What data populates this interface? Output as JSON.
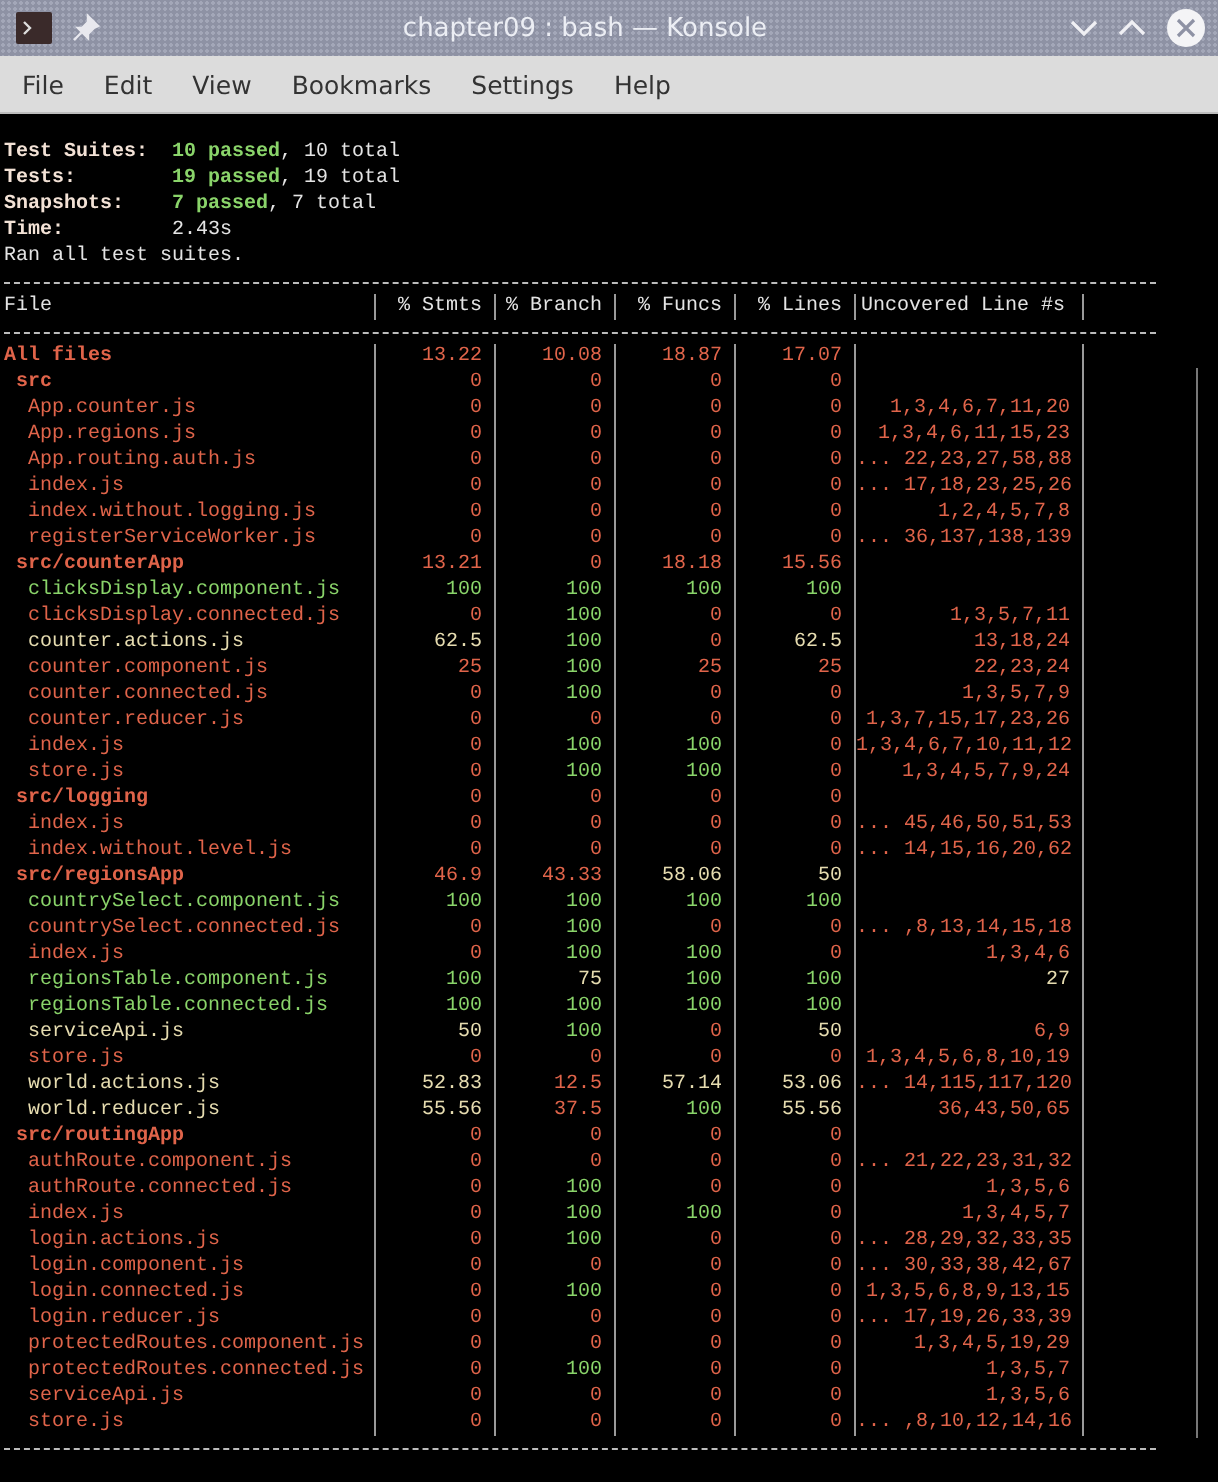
{
  "window": {
    "title": "chapter09 : bash — Konsole"
  },
  "menu": [
    "File",
    "Edit",
    "View",
    "Bookmarks",
    "Settings",
    "Help"
  ],
  "summary": [
    {
      "kind": "counts",
      "label": "Test Suites:",
      "passed": "10 passed",
      "rest": ", 10 total"
    },
    {
      "kind": "counts",
      "label": "Tests:",
      "passed": "19 passed",
      "rest": ", 19 total"
    },
    {
      "kind": "counts",
      "label": "Snapshots:",
      "passed": "7 passed",
      "rest": ", 7 total"
    },
    {
      "kind": "value",
      "label": "Time:",
      "value": "2.43s"
    }
  ],
  "message": "Ran all test suites.",
  "coverage": {
    "columns": [
      "File",
      "% Stmts",
      "% Branch",
      "% Funcs",
      "% Lines",
      "Uncovered Line #s"
    ],
    "rows": [
      {
        "cells": [
          {
            "text": "All files",
            "color": "#e0644a"
          },
          {
            "text": "13.22",
            "color": "#e0644a"
          },
          {
            "text": "10.08",
            "color": "#e0644a"
          },
          {
            "text": "18.87",
            "color": "#e0644a"
          },
          {
            "text": "17.07",
            "color": "#e0644a"
          }
        ],
        "children": [
          {
            "cells": [
              {
                "text": "src",
                "color": "#e0644a"
              },
              {
                "text": "0",
                "color": "#e0644a"
              },
              {
                "text": "0",
                "color": "#e0644a"
              },
              {
                "text": "0",
                "color": "#e0644a"
              },
              {
                "text": "0",
                "color": "#e0644a"
              }
            ],
            "children": [
              {
                "cells": [
                  {
                    "text": "App.counter.js",
                    "color": "#e0644a"
                  },
                  {
                    "text": "0",
                    "color": "#e0644a"
                  },
                  {
                    "text": "0",
                    "color": "#e0644a"
                  },
                  {
                    "text": "0",
                    "color": "#e0644a"
                  },
                  {
                    "text": "0",
                    "color": "#e0644a"
                  },
                  {
                    "text": "1,3,4,6,7,11,20",
                    "color": "#e0644a"
                  }
                ]
              },
              {
                "cells": [
                  {
                    "text": "App.regions.js",
                    "color": "#e0644a"
                  },
                  {
                    "text": "0",
                    "color": "#e0644a"
                  },
                  {
                    "text": "0",
                    "color": "#e0644a"
                  },
                  {
                    "text": "0",
                    "color": "#e0644a"
                  },
                  {
                    "text": "0",
                    "color": "#e0644a"
                  },
                  {
                    "text": "1,3,4,6,11,15,23",
                    "color": "#e0644a"
                  }
                ]
              },
              {
                "cells": [
                  {
                    "text": "App.routing.auth.js",
                    "color": "#e0644a"
                  },
                  {
                    "text": "0",
                    "color": "#e0644a"
                  },
                  {
                    "text": "0",
                    "color": "#e0644a"
                  },
                  {
                    "text": "0",
                    "color": "#e0644a"
                  },
                  {
                    "text": "0",
                    "color": "#e0644a"
                  },
                  {
                    "text": "... 22,23,27,58,88",
                    "color": "#e0644a"
                  }
                ]
              },
              {
                "cells": [
                  {
                    "text": "index.js",
                    "color": "#e0644a"
                  },
                  {
                    "text": "0",
                    "color": "#e0644a"
                  },
                  {
                    "text": "0",
                    "color": "#e0644a"
                  },
                  {
                    "text": "0",
                    "color": "#e0644a"
                  },
                  {
                    "text": "0",
                    "color": "#e0644a"
                  },
                  {
                    "text": "... 17,18,23,25,26",
                    "color": "#e0644a"
                  }
                ]
              },
              {
                "cells": [
                  {
                    "text": "index.without.logging.js",
                    "color": "#e0644a"
                  },
                  {
                    "text": "0",
                    "color": "#e0644a"
                  },
                  {
                    "text": "0",
                    "color": "#e0644a"
                  },
                  {
                    "text": "0",
                    "color": "#e0644a"
                  },
                  {
                    "text": "0",
                    "color": "#e0644a"
                  },
                  {
                    "text": "1,2,4,5,7,8",
                    "color": "#e0644a"
                  }
                ]
              },
              {
                "cells": [
                  {
                    "text": "registerServiceWorker.js",
                    "color": "#e0644a"
                  },
                  {
                    "text": "0",
                    "color": "#e0644a"
                  },
                  {
                    "text": "0",
                    "color": "#e0644a"
                  },
                  {
                    "text": "0",
                    "color": "#e0644a"
                  },
                  {
                    "text": "0",
                    "color": "#e0644a"
                  },
                  {
                    "text": "... 36,137,138,139",
                    "color": "#e0644a"
                  }
                ]
              }
            ]
          },
          {
            "cells": [
              {
                "text": "src/counterApp",
                "color": "#e0644a"
              },
              {
                "text": "13.21",
                "color": "#e0644a"
              },
              {
                "text": "0",
                "color": "#e0644a"
              },
              {
                "text": "18.18",
                "color": "#e0644a"
              },
              {
                "text": "15.56",
                "color": "#e0644a"
              }
            ],
            "children": [
              {
                "cells": [
                  {
                    "text": "clicksDisplay.component.js",
                    "color": "#8ad46a"
                  },
                  {
                    "text": "100",
                    "color": "#8ad46a"
                  },
                  {
                    "text": "100",
                    "color": "#8ad46a"
                  },
                  {
                    "text": "100",
                    "color": "#8ad46a"
                  },
                  {
                    "text": "100",
                    "color": "#8ad46a"
                  }
                ]
              },
              {
                "cells": [
                  {
                    "text": "clicksDisplay.connected.js",
                    "color": "#e0644a"
                  },
                  {
                    "text": "0",
                    "color": "#e0644a"
                  },
                  {
                    "text": "100",
                    "color": "#8ad46a"
                  },
                  {
                    "text": "0",
                    "color": "#e0644a"
                  },
                  {
                    "text": "0",
                    "color": "#e0644a"
                  },
                  {
                    "text": "1,3,5,7,11",
                    "color": "#e0644a"
                  }
                ]
              },
              {
                "cells": [
                  {
                    "text": "counter.actions.js",
                    "color": "#e6dcb0"
                  },
                  {
                    "text": "62.5",
                    "color": "#e6dcb0"
                  },
                  {
                    "text": "100",
                    "color": "#8ad46a"
                  },
                  {
                    "text": "0",
                    "color": "#e0644a"
                  },
                  {
                    "text": "62.5",
                    "color": "#e6dcb0"
                  },
                  {
                    "text": "13,18,24",
                    "color": "#e0644a"
                  }
                ]
              },
              {
                "cells": [
                  {
                    "text": "counter.component.js",
                    "color": "#e0644a"
                  },
                  {
                    "text": "25",
                    "color": "#e0644a"
                  },
                  {
                    "text": "100",
                    "color": "#8ad46a"
                  },
                  {
                    "text": "25",
                    "color": "#e0644a"
                  },
                  {
                    "text": "25",
                    "color": "#e0644a"
                  },
                  {
                    "text": "22,23,24",
                    "color": "#e0644a"
                  }
                ]
              },
              {
                "cells": [
                  {
                    "text": "counter.connected.js",
                    "color": "#e0644a"
                  },
                  {
                    "text": "0",
                    "color": "#e0644a"
                  },
                  {
                    "text": "100",
                    "color": "#8ad46a"
                  },
                  {
                    "text": "0",
                    "color": "#e0644a"
                  },
                  {
                    "text": "0",
                    "color": "#e0644a"
                  },
                  {
                    "text": "1,3,5,7,9",
                    "color": "#e0644a"
                  }
                ]
              },
              {
                "cells": [
                  {
                    "text": "counter.reducer.js",
                    "color": "#e0644a"
                  },
                  {
                    "text": "0",
                    "color": "#e0644a"
                  },
                  {
                    "text": "0",
                    "color": "#e0644a"
                  },
                  {
                    "text": "0",
                    "color": "#e0644a"
                  },
                  {
                    "text": "0",
                    "color": "#e0644a"
                  },
                  {
                    "text": "1,3,7,15,17,23,26",
                    "color": "#e0644a"
                  }
                ]
              },
              {
                "cells": [
                  {
                    "text": "index.js",
                    "color": "#e0644a"
                  },
                  {
                    "text": "0",
                    "color": "#e0644a"
                  },
                  {
                    "text": "100",
                    "color": "#8ad46a"
                  },
                  {
                    "text": "100",
                    "color": "#8ad46a"
                  },
                  {
                    "text": "0",
                    "color": "#e0644a"
                  },
                  {
                    "text": "1,3,4,6,7,10,11,12",
                    "color": "#e0644a"
                  }
                ]
              },
              {
                "cells": [
                  {
                    "text": "store.js",
                    "color": "#e0644a"
                  },
                  {
                    "text": "0",
                    "color": "#e0644a"
                  },
                  {
                    "text": "100",
                    "color": "#8ad46a"
                  },
                  {
                    "text": "100",
                    "color": "#8ad46a"
                  },
                  {
                    "text": "0",
                    "color": "#e0644a"
                  },
                  {
                    "text": "1,3,4,5,7,9,24",
                    "color": "#e0644a"
                  }
                ]
              }
            ]
          },
          {
            "cells": [
              {
                "text": "src/logging",
                "color": "#e0644a"
              },
              {
                "text": "0",
                "color": "#e0644a"
              },
              {
                "text": "0",
                "color": "#e0644a"
              },
              {
                "text": "0",
                "color": "#e0644a"
              },
              {
                "text": "0",
                "color": "#e0644a"
              }
            ],
            "children": [
              {
                "cells": [
                  {
                    "text": "index.js",
                    "color": "#e0644a"
                  },
                  {
                    "text": "0",
                    "color": "#e0644a"
                  },
                  {
                    "text": "0",
                    "color": "#e0644a"
                  },
                  {
                    "text": "0",
                    "color": "#e0644a"
                  },
                  {
                    "text": "0",
                    "color": "#e0644a"
                  },
                  {
                    "text": "... 45,46,50,51,53",
                    "color": "#e0644a"
                  }
                ]
              },
              {
                "cells": [
                  {
                    "text": "index.without.level.js",
                    "color": "#e0644a"
                  },
                  {
                    "text": "0",
                    "color": "#e0644a"
                  },
                  {
                    "text": "0",
                    "color": "#e0644a"
                  },
                  {
                    "text": "0",
                    "color": "#e0644a"
                  },
                  {
                    "text": "0",
                    "color": "#e0644a"
                  },
                  {
                    "text": "... 14,15,16,20,62",
                    "color": "#e0644a"
                  }
                ]
              }
            ]
          },
          {
            "cells": [
              {
                "text": "src/regionsApp",
                "color": "#e0644a"
              },
              {
                "text": "46.9",
                "color": "#e0644a"
              },
              {
                "text": "43.33",
                "color": "#e0644a"
              },
              {
                "text": "58.06",
                "color": "#e6dcb0"
              },
              {
                "text": "50",
                "color": "#e6dcb0"
              }
            ],
            "children": [
              {
                "cells": [
                  {
                    "text": "countrySelect.component.js",
                    "color": "#8ad46a"
                  },
                  {
                    "text": "100",
                    "color": "#8ad46a"
                  },
                  {
                    "text": "100",
                    "color": "#8ad46a"
                  },
                  {
                    "text": "100",
                    "color": "#8ad46a"
                  },
                  {
                    "text": "100",
                    "color": "#8ad46a"
                  }
                ]
              },
              {
                "cells": [
                  {
                    "text": "countrySelect.connected.js",
                    "color": "#e0644a"
                  },
                  {
                    "text": "0",
                    "color": "#e0644a"
                  },
                  {
                    "text": "100",
                    "color": "#8ad46a"
                  },
                  {
                    "text": "0",
                    "color": "#e0644a"
                  },
                  {
                    "text": "0",
                    "color": "#e0644a"
                  },
                  {
                    "text": "... ,8,13,14,15,18",
                    "color": "#e0644a"
                  }
                ]
              },
              {
                "cells": [
                  {
                    "text": "index.js",
                    "color": "#e0644a"
                  },
                  {
                    "text": "0",
                    "color": "#e0644a"
                  },
                  {
                    "text": "100",
                    "color": "#8ad46a"
                  },
                  {
                    "text": "100",
                    "color": "#8ad46a"
                  },
                  {
                    "text": "0",
                    "color": "#e0644a"
                  },
                  {
                    "text": "1,3,4,6",
                    "color": "#e0644a"
                  }
                ]
              },
              {
                "cells": [
                  {
                    "text": "regionsTable.component.js",
                    "color": "#8ad46a"
                  },
                  {
                    "text": "100",
                    "color": "#8ad46a"
                  },
                  {
                    "text": "75",
                    "color": "#e6dcb0"
                  },
                  {
                    "text": "100",
                    "color": "#8ad46a"
                  },
                  {
                    "text": "100",
                    "color": "#8ad46a"
                  },
                  {
                    "text": "27",
                    "color": "#e6dcb0"
                  }
                ]
              },
              {
                "cells": [
                  {
                    "text": "regionsTable.connected.js",
                    "color": "#8ad46a"
                  },
                  {
                    "text": "100",
                    "color": "#8ad46a"
                  },
                  {
                    "text": "100",
                    "color": "#8ad46a"
                  },
                  {
                    "text": "100",
                    "color": "#8ad46a"
                  },
                  {
                    "text": "100",
                    "color": "#8ad46a"
                  }
                ]
              },
              {
                "cells": [
                  {
                    "text": "serviceApi.js",
                    "color": "#e6dcb0"
                  },
                  {
                    "text": "50",
                    "color": "#e6dcb0"
                  },
                  {
                    "text": "100",
                    "color": "#8ad46a"
                  },
                  {
                    "text": "0",
                    "color": "#e0644a"
                  },
                  {
                    "text": "50",
                    "color": "#e6dcb0"
                  },
                  {
                    "text": "6,9",
                    "color": "#e0644a"
                  }
                ]
              },
              {
                "cells": [
                  {
                    "text": "store.js",
                    "color": "#e0644a"
                  },
                  {
                    "text": "0",
                    "color": "#e0644a"
                  },
                  {
                    "text": "0",
                    "color": "#e0644a"
                  },
                  {
                    "text": "0",
                    "color": "#e0644a"
                  },
                  {
                    "text": "0",
                    "color": "#e0644a"
                  },
                  {
                    "text": "1,3,4,5,6,8,10,19",
                    "color": "#e0644a"
                  }
                ]
              },
              {
                "cells": [
                  {
                    "text": "world.actions.js",
                    "color": "#e6dcb0"
                  },
                  {
                    "text": "52.83",
                    "color": "#e6dcb0"
                  },
                  {
                    "text": "12.5",
                    "color": "#e0644a"
                  },
                  {
                    "text": "57.14",
                    "color": "#e6dcb0"
                  },
                  {
                    "text": "53.06",
                    "color": "#e6dcb0"
                  },
                  {
                    "text": "... 14,115,117,120",
                    "color": "#e0644a"
                  }
                ]
              },
              {
                "cells": [
                  {
                    "text": "world.reducer.js",
                    "color": "#e6dcb0"
                  },
                  {
                    "text": "55.56",
                    "color": "#e6dcb0"
                  },
                  {
                    "text": "37.5",
                    "color": "#e0644a"
                  },
                  {
                    "text": "100",
                    "color": "#8ad46a"
                  },
                  {
                    "text": "55.56",
                    "color": "#e6dcb0"
                  },
                  {
                    "text": "36,43,50,65",
                    "color": "#e0644a"
                  }
                ]
              }
            ]
          },
          {
            "cells": [
              {
                "text": "src/routingApp",
                "color": "#e0644a"
              },
              {
                "text": "0",
                "color": "#e0644a"
              },
              {
                "text": "0",
                "color": "#e0644a"
              },
              {
                "text": "0",
                "color": "#e0644a"
              },
              {
                "text": "0",
                "color": "#e0644a"
              }
            ],
            "children": [
              {
                "cells": [
                  {
                    "text": "authRoute.component.js",
                    "color": "#e0644a"
                  },
                  {
                    "text": "0",
                    "color": "#e0644a"
                  },
                  {
                    "text": "0",
                    "color": "#e0644a"
                  },
                  {
                    "text": "0",
                    "color": "#e0644a"
                  },
                  {
                    "text": "0",
                    "color": "#e0644a"
                  },
                  {
                    "text": "... 21,22,23,31,32",
                    "color": "#e0644a"
                  }
                ]
              },
              {
                "cells": [
                  {
                    "text": "authRoute.connected.js",
                    "color": "#e0644a"
                  },
                  {
                    "text": "0",
                    "color": "#e0644a"
                  },
                  {
                    "text": "100",
                    "color": "#8ad46a"
                  },
                  {
                    "text": "0",
                    "color": "#e0644a"
                  },
                  {
                    "text": "0",
                    "color": "#e0644a"
                  },
                  {
                    "text": "1,3,5,6",
                    "color": "#e0644a"
                  }
                ]
              },
              {
                "cells": [
                  {
                    "text": "index.js",
                    "color": "#e0644a"
                  },
                  {
                    "text": "0",
                    "color": "#e0644a"
                  },
                  {
                    "text": "100",
                    "color": "#8ad46a"
                  },
                  {
                    "text": "100",
                    "color": "#8ad46a"
                  },
                  {
                    "text": "0",
                    "color": "#e0644a"
                  },
                  {
                    "text": "1,3,4,5,7",
                    "color": "#e0644a"
                  }
                ]
              },
              {
                "cells": [
                  {
                    "text": "login.actions.js",
                    "color": "#e0644a"
                  },
                  {
                    "text": "0",
                    "color": "#e0644a"
                  },
                  {
                    "text": "100",
                    "color": "#8ad46a"
                  },
                  {
                    "text": "0",
                    "color": "#e0644a"
                  },
                  {
                    "text": "0",
                    "color": "#e0644a"
                  },
                  {
                    "text": "... 28,29,32,33,35",
                    "color": "#e0644a"
                  }
                ]
              },
              {
                "cells": [
                  {
                    "text": "login.component.js",
                    "color": "#e0644a"
                  },
                  {
                    "text": "0",
                    "color": "#e0644a"
                  },
                  {
                    "text": "0",
                    "color": "#e0644a"
                  },
                  {
                    "text": "0",
                    "color": "#e0644a"
                  },
                  {
                    "text": "0",
                    "color": "#e0644a"
                  },
                  {
                    "text": "... 30,33,38,42,67",
                    "color": "#e0644a"
                  }
                ]
              },
              {
                "cells": [
                  {
                    "text": "login.connected.js",
                    "color": "#e0644a"
                  },
                  {
                    "text": "0",
                    "color": "#e0644a"
                  },
                  {
                    "text": "100",
                    "color": "#8ad46a"
                  },
                  {
                    "text": "0",
                    "color": "#e0644a"
                  },
                  {
                    "text": "0",
                    "color": "#e0644a"
                  },
                  {
                    "text": "1,3,5,6,8,9,13,15",
                    "color": "#e0644a"
                  }
                ]
              },
              {
                "cells": [
                  {
                    "text": "login.reducer.js",
                    "color": "#e0644a"
                  },
                  {
                    "text": "0",
                    "color": "#e0644a"
                  },
                  {
                    "text": "0",
                    "color": "#e0644a"
                  },
                  {
                    "text": "0",
                    "color": "#e0644a"
                  },
                  {
                    "text": "0",
                    "color": "#e0644a"
                  },
                  {
                    "text": "... 17,19,26,33,39",
                    "color": "#e0644a"
                  }
                ]
              },
              {
                "cells": [
                  {
                    "text": "protectedRoutes.component.js",
                    "color": "#e0644a"
                  },
                  {
                    "text": "0",
                    "color": "#e0644a"
                  },
                  {
                    "text": "0",
                    "color": "#e0644a"
                  },
                  {
                    "text": "0",
                    "color": "#e0644a"
                  },
                  {
                    "text": "0",
                    "color": "#e0644a"
                  },
                  {
                    "text": "1,3,4,5,19,29",
                    "color": "#e0644a"
                  }
                ]
              },
              {
                "cells": [
                  {
                    "text": "protectedRoutes.connected.js",
                    "color": "#e0644a"
                  },
                  {
                    "text": "0",
                    "color": "#e0644a"
                  },
                  {
                    "text": "100",
                    "color": "#8ad46a"
                  },
                  {
                    "text": "0",
                    "color": "#e0644a"
                  },
                  {
                    "text": "0",
                    "color": "#e0644a"
                  },
                  {
                    "text": "1,3,5,7",
                    "color": "#e0644a"
                  }
                ]
              },
              {
                "cells": [
                  {
                    "text": "serviceApi.js",
                    "color": "#e0644a"
                  },
                  {
                    "text": "0",
                    "color": "#e0644a"
                  },
                  {
                    "text": "0",
                    "color": "#e0644a"
                  },
                  {
                    "text": "0",
                    "color": "#e0644a"
                  },
                  {
                    "text": "0",
                    "color": "#e0644a"
                  },
                  {
                    "text": "1,3,5,6",
                    "color": "#e0644a"
                  }
                ]
              },
              {
                "cells": [
                  {
                    "text": "store.js",
                    "color": "#e0644a"
                  },
                  {
                    "text": "0",
                    "color": "#e0644a"
                  },
                  {
                    "text": "0",
                    "color": "#e0644a"
                  },
                  {
                    "text": "0",
                    "color": "#e0644a"
                  },
                  {
                    "text": "0",
                    "color": "#e0644a"
                  },
                  {
                    "text": "... ,8,10,12,14,16",
                    "color": "#e0644a"
                  }
                ]
              }
            ]
          }
        ]
      }
    ]
  }
}
